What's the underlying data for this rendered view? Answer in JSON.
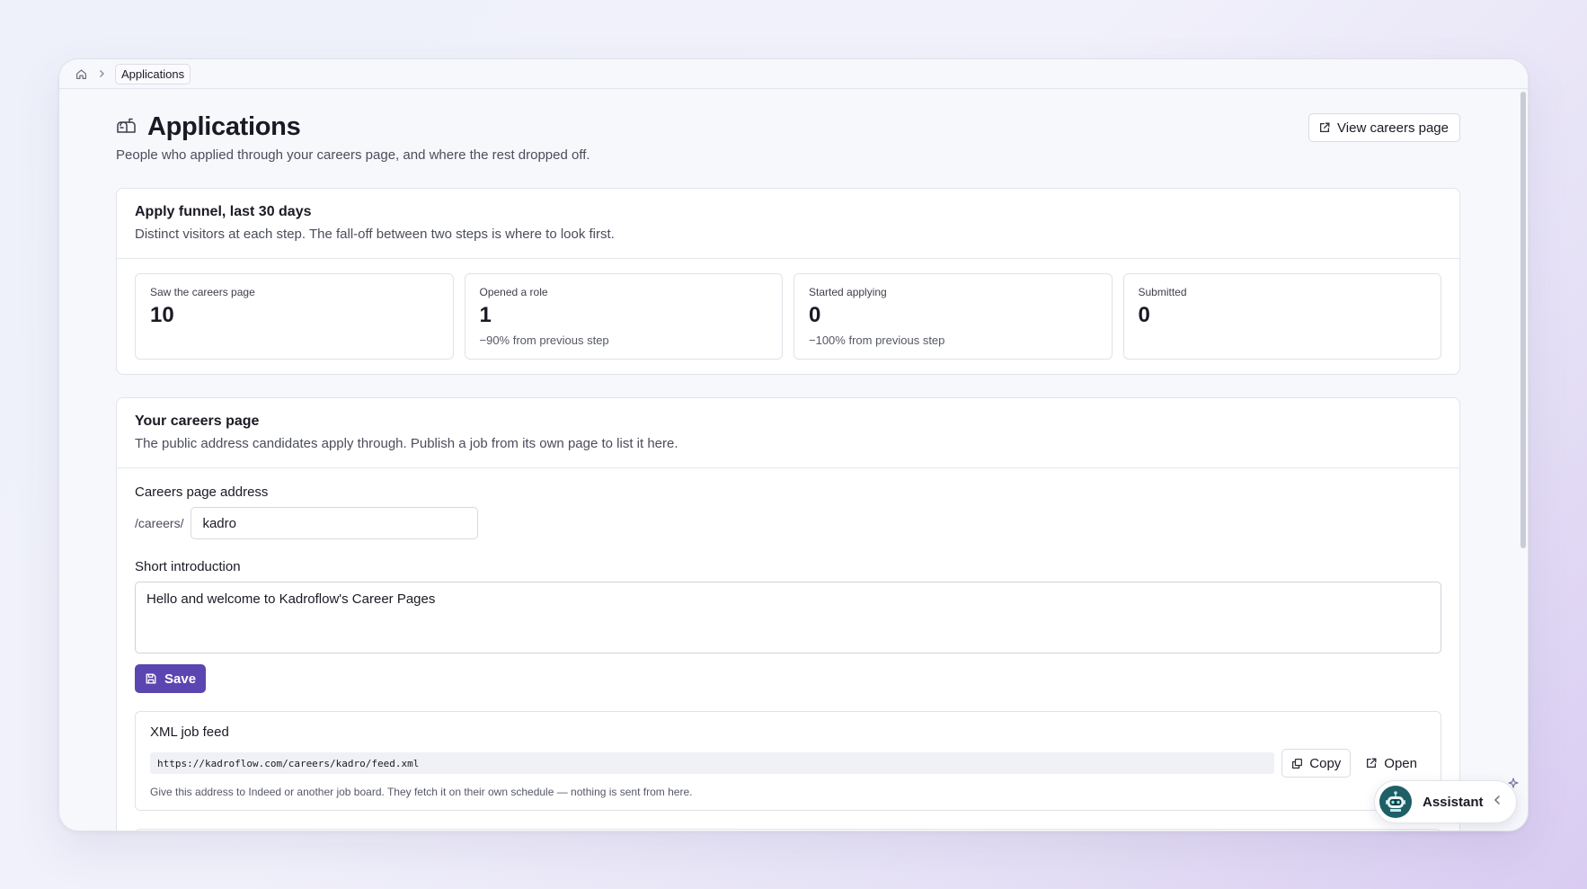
{
  "breadcrumb": {
    "current": "Applications"
  },
  "header": {
    "title": "Applications",
    "subtitle": "People who applied through your careers page, and where the rest dropped off.",
    "view_careers_label": "View careers page"
  },
  "funnel": {
    "title": "Apply funnel, last 30 days",
    "description": "Distinct visitors at each step. The fall-off between two steps is where to look first.",
    "steps": [
      {
        "label": "Saw the careers page",
        "value": "10",
        "delta": ""
      },
      {
        "label": "Opened a role",
        "value": "1",
        "delta": "−90% from previous step"
      },
      {
        "label": "Started applying",
        "value": "0",
        "delta": "−100% from previous step"
      },
      {
        "label": "Submitted",
        "value": "0",
        "delta": ""
      }
    ]
  },
  "careers": {
    "title": "Your careers page",
    "description": "The public address candidates apply through. Publish a job from its own page to list it here.",
    "address_label": "Careers page address",
    "address_prefix": "/careers/",
    "address_value": "kadro",
    "intro_label": "Short introduction",
    "intro_value": "Hello and welcome to Kadroflow's Career Pages",
    "save_label": "Save"
  },
  "feed": {
    "title": "XML job feed",
    "url": "https://kadroflow.com/careers/kadro/feed.xml",
    "copy_label": "Copy",
    "open_label": "Open",
    "help": "Give this address to Indeed or another job board. They fetch it on their own schedule — nothing is sent from here."
  },
  "assistant": {
    "label": "Assistant"
  },
  "colors": {
    "accent": "#5b45b0",
    "avatar": "#1f5f66"
  },
  "icons": [
    "home-icon",
    "chevron-right-icon",
    "mailbox-icon",
    "external-link-icon",
    "save-icon",
    "copy-icon",
    "robot-icon",
    "chevron-left-icon",
    "sparkle-icon"
  ]
}
